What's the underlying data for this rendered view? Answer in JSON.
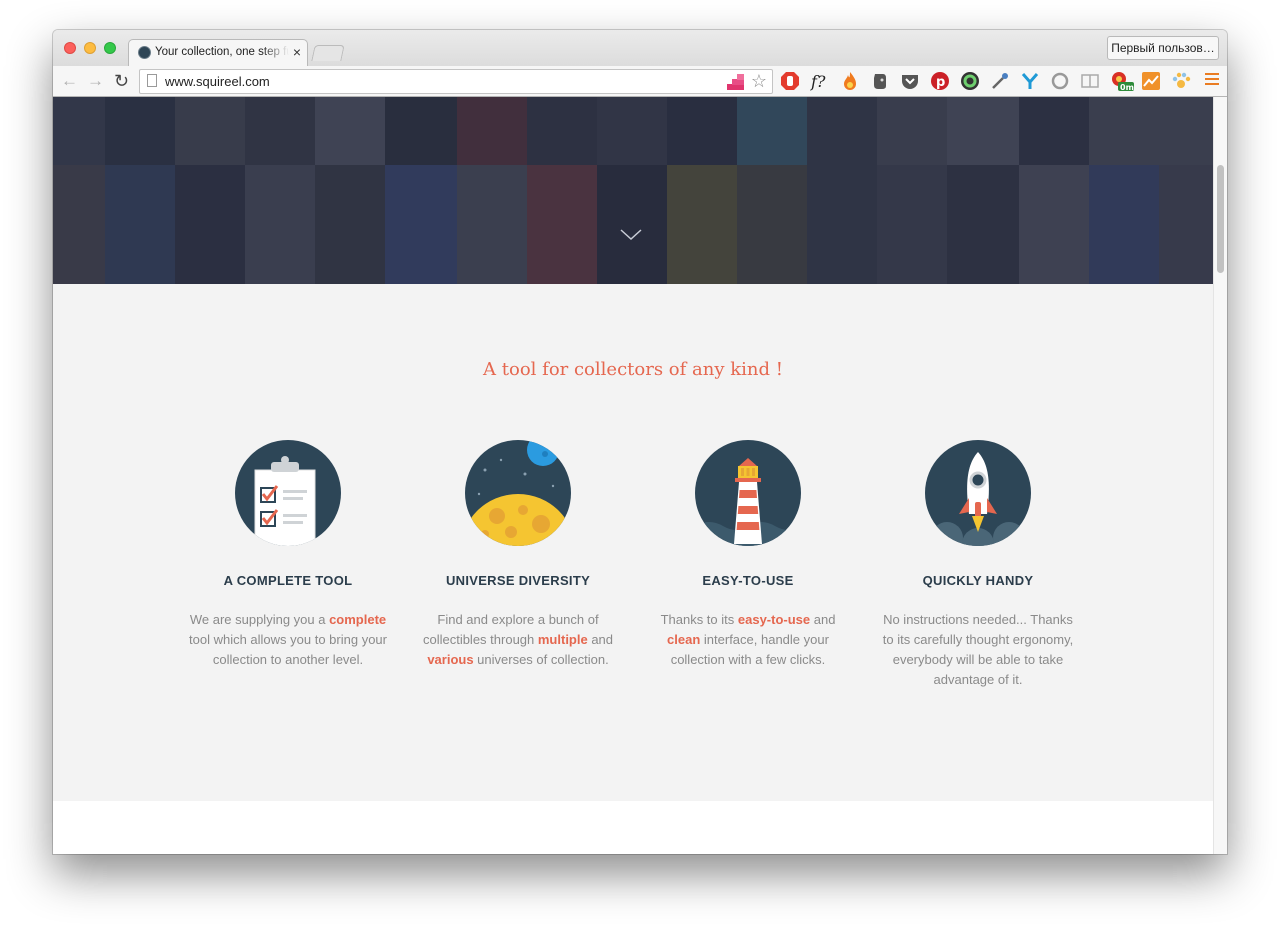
{
  "browser": {
    "tab_title": "Your collection, one step further",
    "tab_close": "×",
    "profile_button": "Первый пользов…",
    "url": "www.squireel.com",
    "extension_badge": "0m",
    "nav": {
      "back": "←",
      "forward": "→",
      "reload": "↻"
    },
    "star": "☆"
  },
  "extensions": [
    "omni-extension-icon",
    "adblock-icon",
    "font-finder-icon",
    "fire-icon",
    "evernote-icon",
    "pocket-icon",
    "pinterest-icon",
    "color-circle-icon",
    "eyedropper-icon",
    "y-icon",
    "refresh-ring-icon",
    "reader-icon",
    "chrome-badge-icon",
    "analytics-icon",
    "paw-icon",
    "menu-icon"
  ],
  "colors": {
    "accent": "#e5674f",
    "icon_bg": "#2d4657",
    "page_bg": "#f3f3f3",
    "feature_title": "#2b3d4b",
    "body_text": "#8a8a8a"
  },
  "page": {
    "section_title": "A tool for collectors of any kind !",
    "features": [
      {
        "icon": "clipboard-checklist-icon",
        "title": "A COMPLETE TOOL",
        "desc_parts": [
          "We are supplying you a ",
          "complete",
          " tool which allows you to bring your collection to another level."
        ]
      },
      {
        "icon": "planet-moon-icon",
        "title": "UNIVERSE DIVERSITY",
        "desc_parts": [
          "Find and explore a bunch of collectibles through ",
          "multiple",
          " and ",
          "various",
          " universes of collection."
        ]
      },
      {
        "icon": "lighthouse-icon",
        "title": "EASY-TO-USE",
        "desc_parts": [
          "Thanks to its ",
          "easy-to-use",
          " and ",
          "clean",
          " interface, handle your collection with a few clicks."
        ]
      },
      {
        "icon": "rocket-icon",
        "title": "QUICKLY HANDY",
        "desc_parts": [
          "No instructions needed... Thanks to its carefully thought ergonomy, everybody will be able to take advantage of it."
        ]
      }
    ]
  }
}
